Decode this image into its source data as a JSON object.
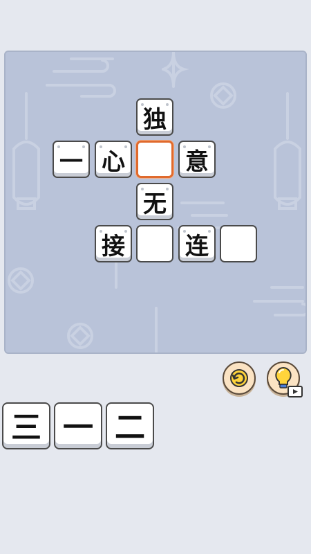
{
  "board": {
    "cells": [
      {
        "id": "du",
        "text": "独",
        "state": "filled"
      },
      {
        "id": "yi",
        "text": "一",
        "state": "filled"
      },
      {
        "id": "xin",
        "text": "心",
        "state": "filled"
      },
      {
        "id": "blank1",
        "text": "",
        "state": "selected"
      },
      {
        "id": "yi2",
        "text": "意",
        "state": "filled"
      },
      {
        "id": "wu",
        "text": "无",
        "state": "filled"
      },
      {
        "id": "jie",
        "text": "接",
        "state": "filled"
      },
      {
        "id": "blank2",
        "text": "",
        "state": "empty"
      },
      {
        "id": "lian",
        "text": "连",
        "state": "filled"
      },
      {
        "id": "blank3",
        "text": "",
        "state": "empty"
      }
    ]
  },
  "controls": {
    "refresh_icon": "refresh-icon",
    "hint_icon": "lightbulb-icon",
    "video_icon": "video-play-icon"
  },
  "tiles": [
    {
      "text": "三"
    },
    {
      "text": "一"
    },
    {
      "text": "二"
    }
  ],
  "colors": {
    "background": "#e5e8ef",
    "board": "#b9c3d9",
    "selected_border": "#e06a2d",
    "button_fill": "#fbe3c3",
    "bulb": "#ffd43b"
  }
}
